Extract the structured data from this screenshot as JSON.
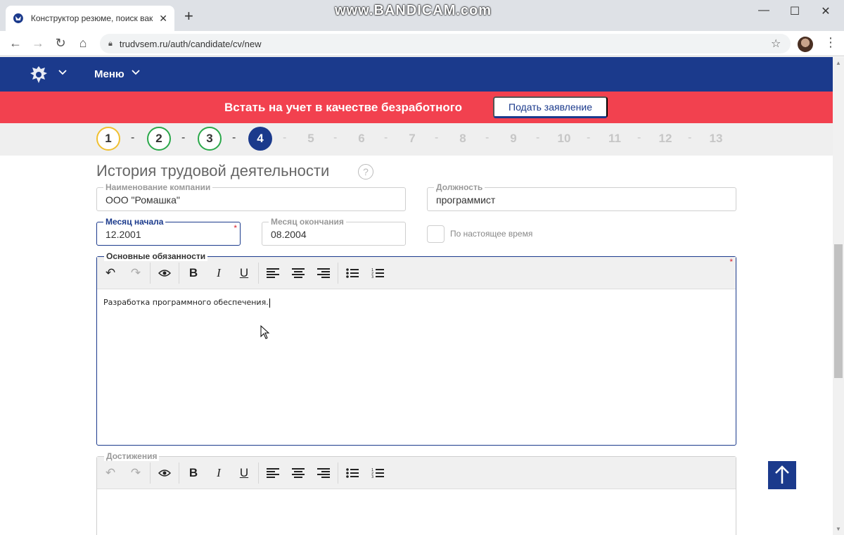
{
  "browser": {
    "tab_title": "Конструктор резюме, поиск вак",
    "tab_close": "✕",
    "new_tab": "+",
    "watermark": "www.BANDICAM.com",
    "url": "trudvsem.ru/auth/candidate/cv/new"
  },
  "header": {
    "menu_label": "Меню"
  },
  "banner": {
    "text": "Встать на учет в качестве безработного",
    "button_label": "Подать заявление",
    "color": "#f2414f"
  },
  "steps": {
    "items": [
      "1",
      "2",
      "3",
      "4",
      "5",
      "6",
      "7",
      "8",
      "9",
      "10",
      "11",
      "12",
      "13"
    ],
    "separator": "-",
    "current": 4
  },
  "form": {
    "section_title": "История трудовой деятельности",
    "help": "?",
    "company": {
      "label": "Наименование компании",
      "value": "ООО \"Ромашка\""
    },
    "position": {
      "label": "Должность",
      "value": "программист"
    },
    "start_month": {
      "label": "Месяц начала",
      "value": "12.2001",
      "required": "*"
    },
    "end_month": {
      "label": "Месяц окончания",
      "value": "08.2004"
    },
    "present_label": "По настоящее время",
    "duties": {
      "label": "Основные обязанности",
      "text": "Разработка программного обеспечения.",
      "required": "*"
    },
    "achievements": {
      "label": "Достижения",
      "text": ""
    }
  },
  "colors": {
    "brand_blue": "#1b3a8c",
    "step_done_yellow": "#f0c030",
    "step_done_green": "#2aa84a"
  }
}
